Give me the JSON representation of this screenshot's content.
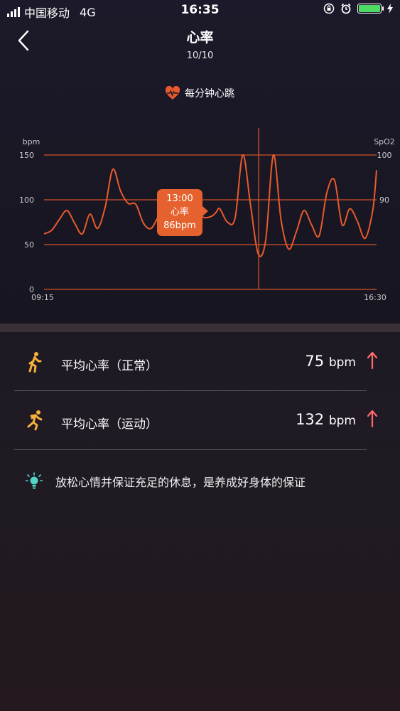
{
  "status_bar": {
    "carrier": "中国移动",
    "network": "4G",
    "time": "16:35",
    "battery_color": "#4cd964"
  },
  "header": {
    "title": "心率",
    "date": "10/10"
  },
  "legend": {
    "label": "每分钟心跳",
    "icon": "heart-pulse-icon"
  },
  "chart_data": {
    "type": "line",
    "left_axis_label": "bpm",
    "right_axis_label": "SpO2",
    "left_ticks": [
      "150",
      "100",
      "50",
      "0"
    ],
    "right_ticks": [
      "100",
      "90"
    ],
    "x_tick_labels": [
      "09:15",
      "16:30"
    ],
    "ylim": [
      0,
      150
    ],
    "series": [
      {
        "color": "#e85a2c",
        "x": [
          "09:15",
          "09:25",
          "09:35",
          "09:45",
          "09:55",
          "10:05",
          "10:15",
          "10:25",
          "10:35",
          "10:45",
          "10:55",
          "11:05",
          "11:15",
          "11:25",
          "11:35",
          "11:45",
          "11:55",
          "12:05",
          "12:15",
          "12:25",
          "12:35",
          "12:45",
          "12:55",
          "13:00",
          "13:05",
          "13:15",
          "13:25",
          "13:35",
          "13:45",
          "13:55",
          "14:05",
          "14:15",
          "14:25",
          "14:35",
          "14:45",
          "14:55",
          "15:05",
          "15:15",
          "15:25",
          "15:35",
          "15:45",
          "15:55",
          "16:05",
          "16:15",
          "16:25",
          "16:30"
        ],
        "values": [
          62,
          66,
          78,
          88,
          74,
          62,
          84,
          68,
          92,
          134,
          110,
          96,
          95,
          74,
          68,
          82,
          92,
          88,
          70,
          92,
          86,
          80,
          82,
          86,
          90,
          75,
          80,
          150,
          95,
          40,
          55,
          150,
          78,
          45,
          64,
          88,
          72,
          60,
          108,
          122,
          72,
          90,
          76,
          57,
          88,
          133
        ]
      }
    ],
    "highlight": {
      "x": "13:00",
      "label_time": "13:00",
      "label_name": "心率",
      "label_value": "86bpm"
    }
  },
  "stats": [
    {
      "label": "平均心率（正常）",
      "value": "75",
      "unit": "bpm",
      "icon": "walking-icon",
      "trend": "up"
    },
    {
      "label": "平均心率（运动）",
      "value": "132",
      "unit": "bpm",
      "icon": "running-icon",
      "trend": "up"
    }
  ],
  "tip": {
    "text": "放松心情并保证充足的休息，是养成好身体的保证",
    "icon": "lightbulb-icon"
  },
  "colors": {
    "accent": "#e85a2c",
    "icon_yellow": "#f5b13a",
    "arrow_red": "#ff6b6b",
    "tip_icon": "#4fd6c6"
  }
}
